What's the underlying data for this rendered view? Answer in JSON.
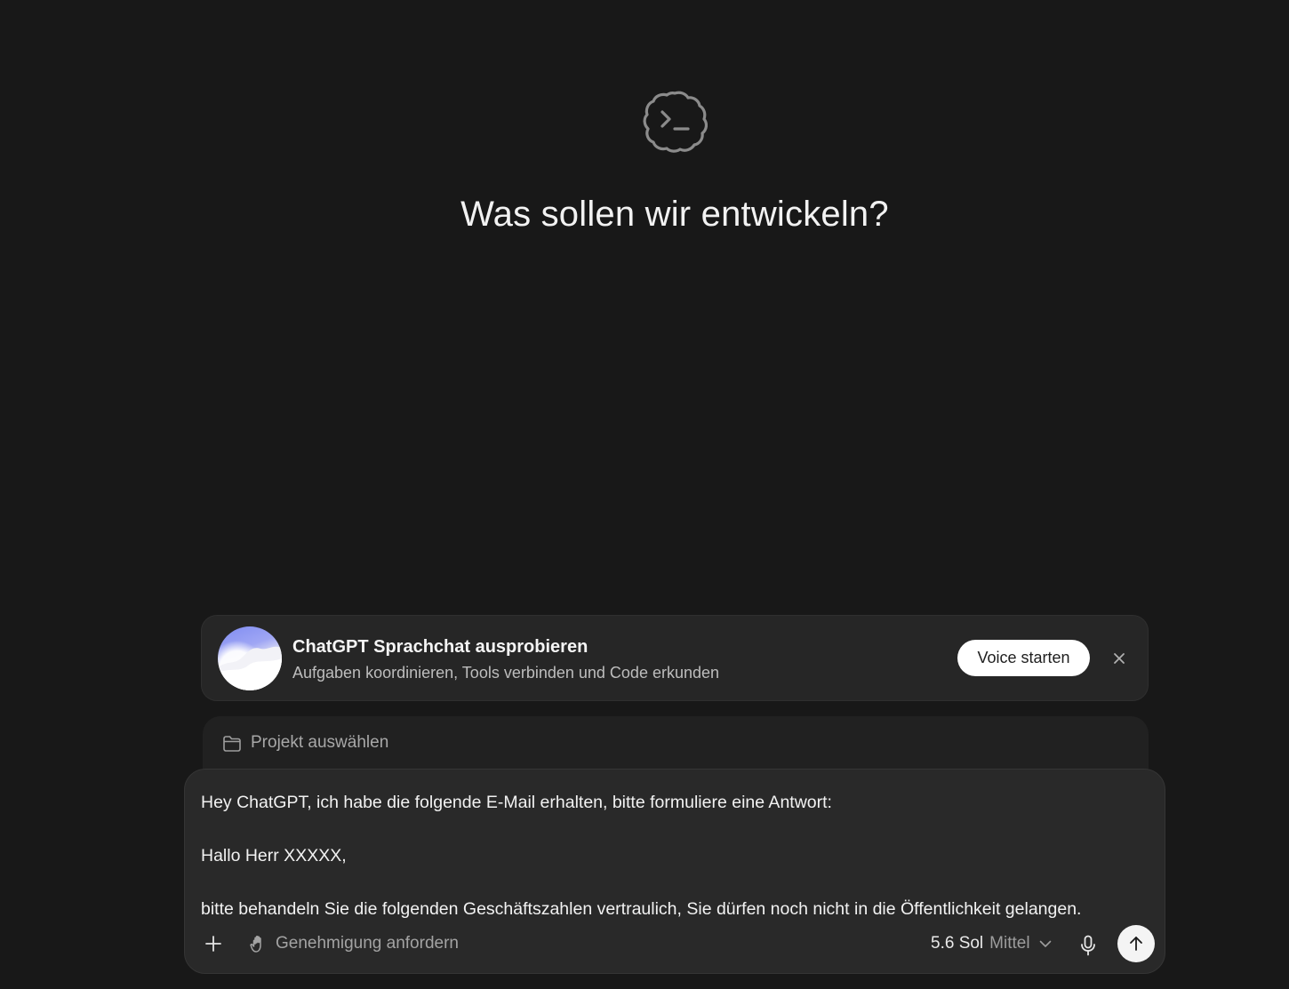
{
  "header": {
    "title": "Was sollen wir entwickeln?",
    "logo_icon": "terminal-cloud-icon"
  },
  "promo": {
    "title": "ChatGPT Sprachchat ausprobieren",
    "subtitle": "Aufgaben koordinieren, Tools verbinden und Code erkunden",
    "button_label": "Voice starten",
    "close_icon": "close-icon"
  },
  "project": {
    "label": "Projekt auswählen",
    "icon": "folder-icon"
  },
  "composer": {
    "lines": [
      "Hey ChatGPT, ich habe die folgende E-Mail erhalten, bitte formuliere eine Antwort:",
      "",
      "Hallo Herr XXXXX,",
      "",
      "bitte behandeln Sie die folgenden Geschäftszahlen vertraulich, Sie dürfen noch nicht in die Öffentlichkeit gelangen."
    ],
    "approval_label": "Genehmigung anfordern",
    "approval_icon": "hand-icon",
    "model_name": "5.6 Sol",
    "model_effort": "Mittel",
    "plus_icon": "plus-icon",
    "mic_icon": "microphone-icon",
    "send_icon": "arrow-up-icon"
  },
  "colors": {
    "background": "#181818",
    "card": "#262626",
    "composer": "#292929",
    "accent_avatar": "#7f8cf2"
  }
}
